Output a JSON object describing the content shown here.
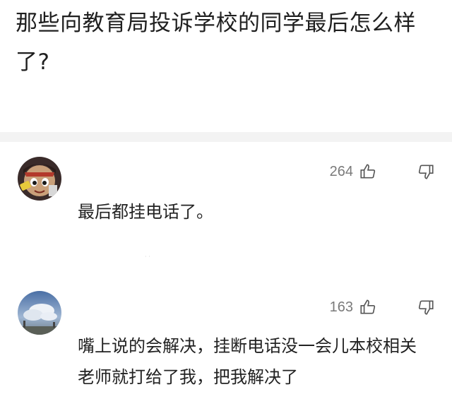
{
  "question": {
    "title": "那些向教育局投诉学校的同学最后怎么样了?"
  },
  "comments": [
    {
      "avatar_icon": "cartoon-character-avatar",
      "like_count": "264",
      "like_icon": "thumb-up-icon",
      "dislike_icon": "thumb-down-icon",
      "text": "最后都挂电话了。"
    },
    {
      "avatar_icon": "sky-clouds-avatar",
      "like_count": "163",
      "like_icon": "thumb-up-icon",
      "dislike_icon": "thumb-down-icon",
      "text": "嘴上说的会解决，挂断电话没一会儿本校相关老师就打给了我，把我解决了"
    }
  ],
  "colors": {
    "text": "#222222",
    "muted": "#7a7a7a",
    "band": "#f3f3f3"
  }
}
